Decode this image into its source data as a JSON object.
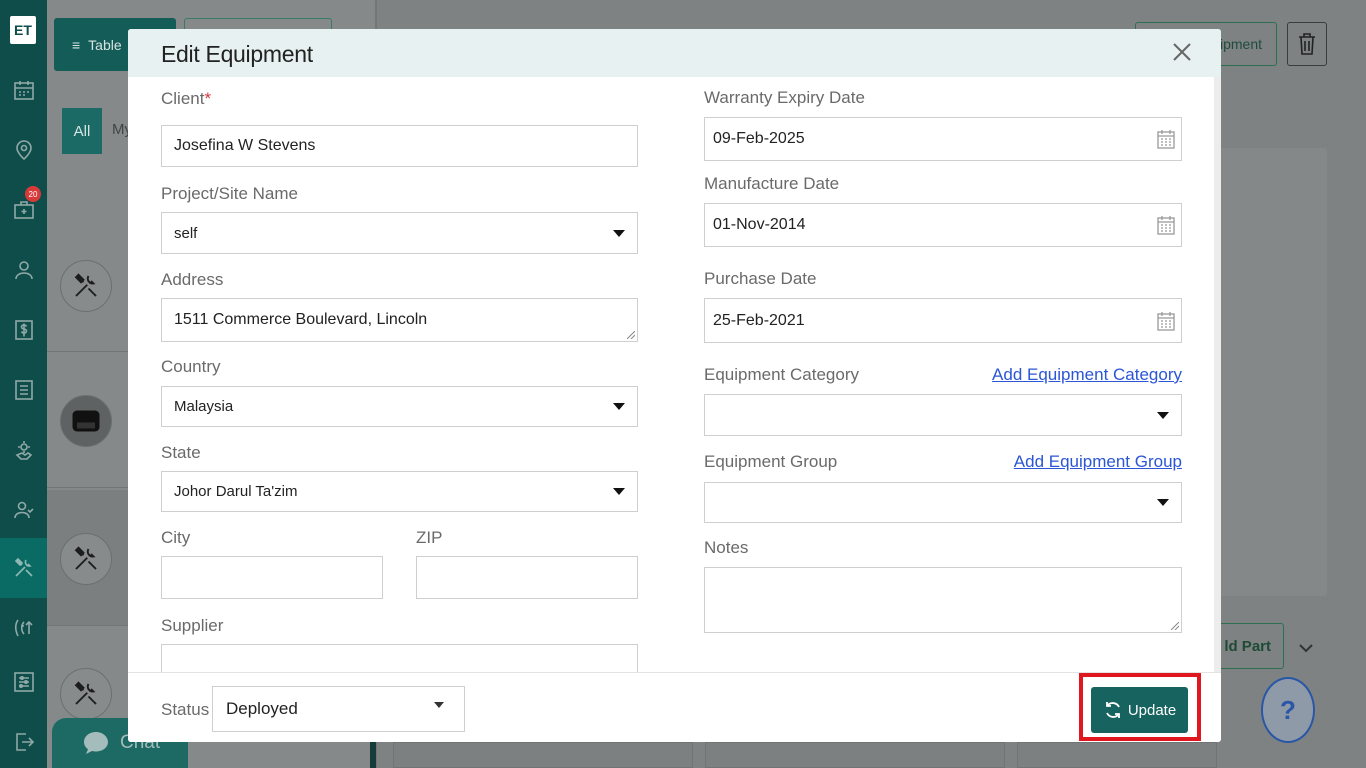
{
  "sidebar": {
    "logo": "ET",
    "badge_count": "20",
    "items": [
      "calendar-icon",
      "map-pin-icon",
      "briefcase-icon",
      "user-icon",
      "dollar-icon",
      "list-icon",
      "settings-hand-icon",
      "users-icon",
      "tools-icon",
      "handshake-icon",
      "sliders-icon",
      "logout-icon"
    ]
  },
  "background": {
    "top_button_label": "Table",
    "tab_all": "All",
    "tab_my": "My",
    "add_equipment_partial": "ipment",
    "add_part_partial": "ld Part",
    "chat_label": "Chat",
    "help_label": "?"
  },
  "modal": {
    "title": "Edit Equipment",
    "close_label": "×",
    "left": {
      "client_label": "Client",
      "client_required": "*",
      "client_value": "Josefina W Stevens",
      "project_label": "Project/Site Name",
      "project_value": "self",
      "address_label": "Address",
      "address_value": "1511  Commerce Boulevard, Lincoln",
      "country_label": "Country",
      "country_value": "Malaysia",
      "state_label": "State",
      "state_value": "Johor Darul Ta'zim",
      "city_label": "City",
      "city_value": "",
      "zip_label": "ZIP",
      "zip_value": "",
      "supplier_label": "Supplier",
      "supplier_value": ""
    },
    "right": {
      "warranty_label": "Warranty Expiry Date",
      "warranty_value": "09-Feb-2025",
      "manufacture_label": "Manufacture Date",
      "manufacture_value": "01-Nov-2014",
      "purchase_label": "Purchase Date",
      "purchase_value": "25-Feb-2021",
      "category_label": "Equipment Category",
      "category_link": "Add Equipment Category",
      "category_value": "",
      "group_label": "Equipment Group",
      "group_link": "Add Equipment Group",
      "group_value": "",
      "notes_label": "Notes",
      "notes_value": ""
    },
    "footer": {
      "status_label": "Status",
      "status_value": "Deployed",
      "update_label": "Update"
    }
  },
  "colors": {
    "primary": "#176360",
    "highlight": "#e0171f",
    "link": "#2b56d6"
  }
}
